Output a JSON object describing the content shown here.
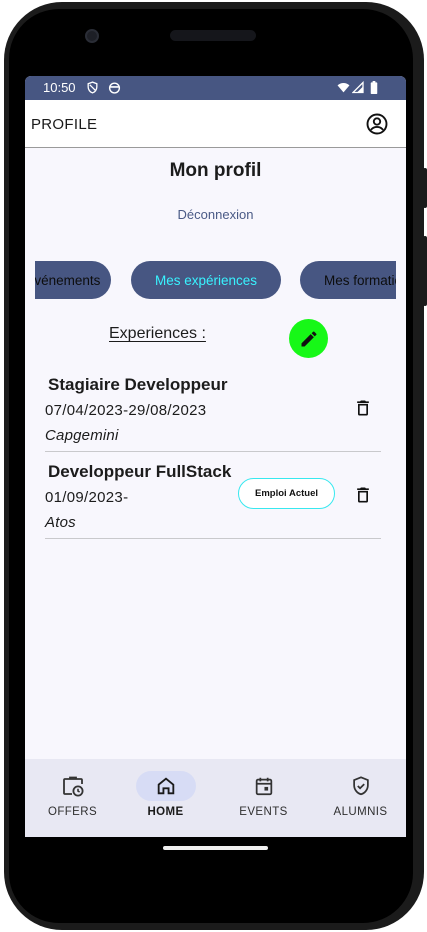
{
  "status_bar": {
    "time": "10:50",
    "icons": [
      "shield-icon",
      "face-icon",
      "wifi-icon",
      "signal-icon",
      "battery-icon"
    ]
  },
  "app_bar": {
    "title": "PROFILE",
    "account_icon": "account-circle-icon"
  },
  "profile": {
    "title": "Mon profil",
    "logout_label": "Déconnexion"
  },
  "tabs": [
    {
      "label": "Mes événements",
      "selected": false
    },
    {
      "label": "Mes expériences",
      "selected": true
    },
    {
      "label": "Mes formations",
      "selected": false
    }
  ],
  "experiences_section": {
    "label": "Experiences :",
    "edit_icon": "pencil-icon"
  },
  "experiences": [
    {
      "title": "Stagiaire Developpeur",
      "dates": "07/04/2023-29/08/2023",
      "company": "Capgemini",
      "current_badge": ""
    },
    {
      "title": "Developpeur FullStack",
      "dates": "01/09/2023-",
      "company": "Atos",
      "current_badge": "Emploi Actuel"
    }
  ],
  "bottom_nav": [
    {
      "label": "OFFERS",
      "icon": "briefcase-clock-icon",
      "active": false
    },
    {
      "label": "HOME",
      "icon": "home-icon",
      "active": true
    },
    {
      "label": "EVENTS",
      "icon": "calendar-icon",
      "active": false
    },
    {
      "label": "ALUMNIS",
      "icon": "verified-shield-icon",
      "active": false
    }
  ],
  "colors": {
    "primary": "#475682",
    "tab_selected_text": "#38f3ff",
    "fab": "#17f817",
    "badge_border": "#38e8ef",
    "nav_background": "#e8e8f3",
    "nav_active_pill": "#d7dcf5"
  }
}
